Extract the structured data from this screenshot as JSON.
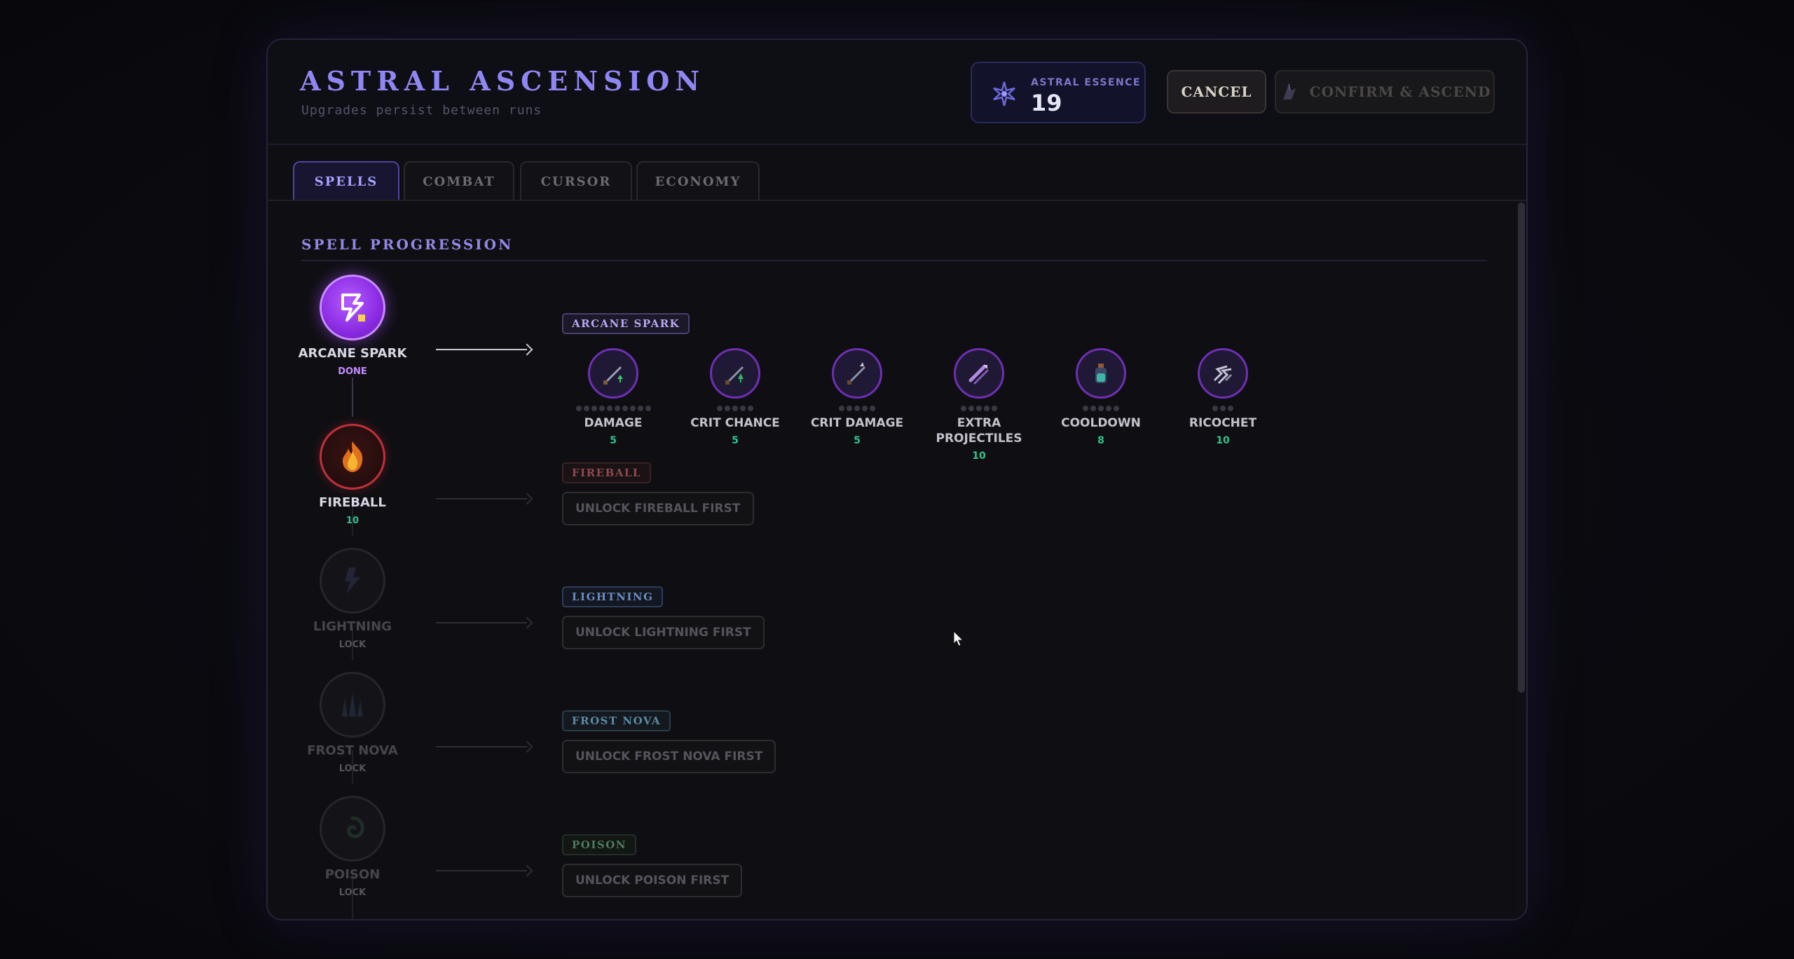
{
  "header": {
    "title": "ASTRAL ASCENSION",
    "subtitle": "Upgrades persist between runs",
    "essence_label": "ASTRAL ESSENCE",
    "essence_value": "19",
    "cancel_label": "CANCEL",
    "confirm_label": "CONFIRM & ASCEND"
  },
  "tabs": [
    {
      "label": "SPELLS",
      "active": true
    },
    {
      "label": "COMBAT",
      "active": false
    },
    {
      "label": "CURSOR",
      "active": false
    },
    {
      "label": "ECONOMY",
      "active": false
    }
  ],
  "section_title": "SPELL PROGRESSION",
  "spells": [
    {
      "name": "ARCANE SPARK",
      "status": "DONE",
      "icon": "arcane-spark-icon",
      "color": "#a94cf0"
    },
    {
      "name": "FIREBALL",
      "status": "10",
      "icon": "fireball-icon",
      "color": "#c0303a"
    },
    {
      "name": "LIGHTNING",
      "status": "LOCK",
      "icon": "lightning-icon",
      "color": "#2a2a30"
    },
    {
      "name": "FROST NOVA",
      "status": "LOCK",
      "icon": "frost-nova-icon",
      "color": "#2a2a30"
    },
    {
      "name": "POISON",
      "status": "LOCK",
      "icon": "poison-icon",
      "color": "#2a2a30"
    }
  ],
  "branches": [
    {
      "tag": "ARCANE SPARK",
      "lock_text": ""
    },
    {
      "tag": "FIREBALL",
      "lock_text": "UNLOCK FIREBALL FIRST"
    },
    {
      "tag": "LIGHTNING",
      "lock_text": "UNLOCK LIGHTNING FIRST"
    },
    {
      "tag": "FROST NOVA",
      "lock_text": "UNLOCK FROST NOVA FIRST"
    },
    {
      "tag": "POISON",
      "lock_text": "UNLOCK POISON FIRST"
    }
  ],
  "upgrades": [
    {
      "name": "DAMAGE",
      "cost": "5",
      "max_level": 10,
      "level": 0,
      "icon": "sword-up-icon"
    },
    {
      "name": "CRIT CHANCE",
      "cost": "5",
      "max_level": 5,
      "level": 0,
      "icon": "crit-chance-icon"
    },
    {
      "name": "CRIT DAMAGE",
      "cost": "5",
      "max_level": 5,
      "level": 0,
      "icon": "crit-damage-icon"
    },
    {
      "name": "EXTRA PROJECTILES",
      "cost": "10",
      "max_level": 5,
      "level": 0,
      "icon": "projectiles-icon"
    },
    {
      "name": "COOLDOWN",
      "cost": "8",
      "max_level": 5,
      "level": 0,
      "icon": "potion-icon"
    },
    {
      "name": "RICOCHET",
      "cost": "10",
      "max_level": 3,
      "level": 0,
      "icon": "ricochet-icon"
    }
  ]
}
